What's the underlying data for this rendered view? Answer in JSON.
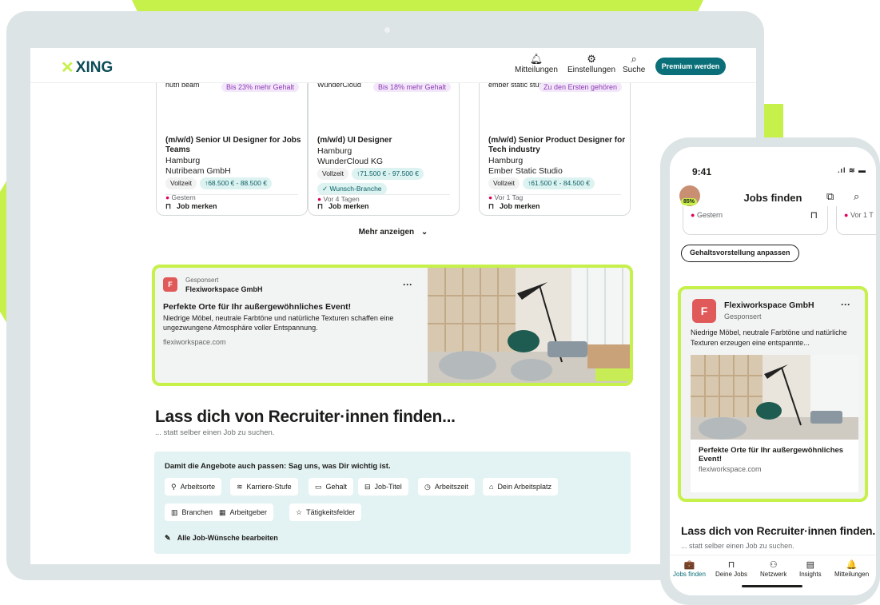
{
  "header": {
    "logo_text": "XING",
    "nav": [
      {
        "label": "Mitteilungen",
        "icon": "bell-icon",
        "glyph": "🔔"
      },
      {
        "label": "Einstellungen",
        "icon": "gear-icon",
        "glyph": "⚙"
      },
      {
        "label": "Suche",
        "icon": "search-icon",
        "glyph": "⌕"
      }
    ],
    "premium_label": "Premium werden"
  },
  "job_cards": [
    {
      "company_logo": "nutri beam",
      "badge": "Bis 23% mehr Gehalt",
      "title": "(m/w/d) Senior UI Designer for Jobs Teams",
      "city": "Hamburg",
      "company": "Nutribeam GmbH",
      "type": "Vollzeit",
      "salary": "↑68.500 € - 88.500 €",
      "wish": "",
      "posted": "Gestern",
      "save_label": "Job merken"
    },
    {
      "company_logo": "WunderCloud",
      "badge": "Bis 18% mehr Gehalt",
      "title": "(m/w/d) UI Designer",
      "city": "Hamburg",
      "company": "WunderCloud KG",
      "type": "Vollzeit",
      "salary": "↑71.500 € - 97.500 €",
      "wish": "✓ Wunsch-Branche",
      "posted": "Vor 4 Tagen",
      "save_label": "Job merken"
    },
    {
      "company_logo": "ember static studio",
      "badge": "Zu den Ersten gehören",
      "title": "(m/w/d) Senior Product Designer for Tech industry",
      "city": "Hamburg",
      "company": "Ember Static Studio",
      "type": "Vollzeit",
      "salary": "↑61.500 € - 84.500 €",
      "wish": "",
      "posted": "Vor 1 Tag",
      "save_label": "Job merken"
    }
  ],
  "more_label": "Mehr anzeigen",
  "ad": {
    "sponsored": "Gesponsert",
    "company": "Flexiworkspace GmbH",
    "headline": "Perfekte Orte für Ihr außergewöhnliches Event!",
    "description": "Niedrige Möbel, neutrale Farbtöne und natürliche Texturen schaffen eine ungezwungene Atmosphäre voller Entspannung.",
    "url": "flexiworkspace.com",
    "more": "···",
    "logo_letter": "F"
  },
  "recruiter": {
    "title": "Lass dich von Recruiter·innen finden...",
    "subtitle": "... statt selber einen Job zu suchen.",
    "prefs_title": "Damit die Angebote auch passen: Sag uns, was Dir wichtig ist.",
    "pills": [
      {
        "label": "Arbeitsorte",
        "icon": "location-pin-icon",
        "glyph": "⚲"
      },
      {
        "label": "Karriere-Stufe",
        "icon": "career-level-icon",
        "glyph": "≋"
      },
      {
        "label": "Gehalt",
        "icon": "salary-icon",
        "glyph": "▭"
      },
      {
        "label": "Job-Titel",
        "icon": "job-title-icon",
        "glyph": "⊟"
      },
      {
        "label": "Arbeitszeit",
        "icon": "clock-icon",
        "glyph": "◷"
      },
      {
        "label": "Dein Arbeitsplatz",
        "icon": "home-icon",
        "glyph": "⌂"
      },
      {
        "label": "Branchen",
        "icon": "industry-icon",
        "glyph": "▥"
      },
      {
        "label": "Arbeitgeber",
        "icon": "employer-icon",
        "glyph": "▦"
      },
      {
        "label": "Tätigkeitsfelder",
        "icon": "field-icon",
        "glyph": "☆"
      }
    ],
    "edit_label": "Alle Job-Wünsche bearbeiten"
  },
  "phone": {
    "time": "9:41",
    "signal": ".ıl ≋ ▬",
    "avatar_badge": "85%",
    "title": "Jobs finden",
    "card_posted": "Gestern",
    "card2_posted": "Vor 1 T",
    "salary_button": "Gehaltsvorstellung anpassen",
    "ad": {
      "company": "Flexiworkspace GmbH",
      "sponsored": "Gesponsert",
      "description": "Niedrige Möbel, neutrale Farbtöne und natürliche Texturen erzeugen eine entspannte...",
      "headline": "Perfekte Orte für Ihr außergewöhnliches Event!",
      "url": "flexiworkspace.com",
      "more": "···",
      "logo_letter": "F"
    },
    "section_title": "Lass dich von Recruiter·innen finden...",
    "section_subtitle": "... statt selber einen Job zu suchen.",
    "tabs": [
      {
        "label": "Jobs finden",
        "icon": "briefcase-icon",
        "glyph": "💼",
        "active": true
      },
      {
        "label": "Deine Jobs",
        "icon": "bookmark-icon",
        "glyph": "⊓",
        "active": false
      },
      {
        "label": "Netzwerk",
        "icon": "people-icon",
        "glyph": "⚇",
        "active": false
      },
      {
        "label": "Insights",
        "icon": "insights-icon",
        "glyph": "▤",
        "active": false
      },
      {
        "label": "Mitteilungen",
        "icon": "bell-icon",
        "glyph": "🔔",
        "active": false
      }
    ]
  },
  "colors": {
    "accent_green": "#c6f04a",
    "brand_teal": "#0a6f78",
    "device_frame": "#dde4e6",
    "prefs_bg": "#e3f2f2"
  }
}
